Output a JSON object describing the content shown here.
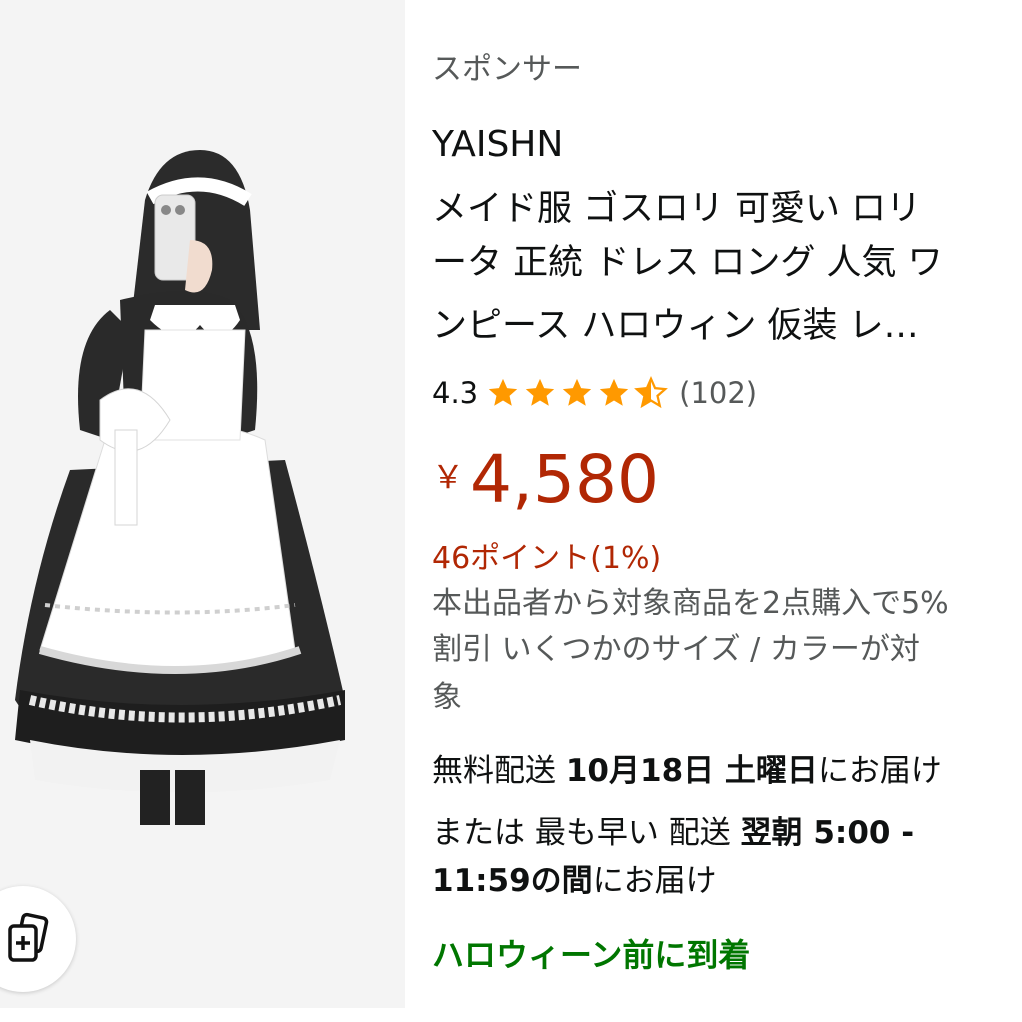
{
  "product": {
    "sponsored_label": "スポンサー",
    "brand": "YAISHN",
    "title_lines": [
      "メイド服 ゴスロリ 可愛い ロリ",
      "ータ 正統 ドレス ロング 人気 ワ",
      "ンピース ハロウィン 仮装 レ…"
    ],
    "rating": {
      "value": "4.3",
      "stars": 4.3,
      "review_count": "(102)"
    },
    "price": {
      "currency": "￥",
      "amount": "4,580"
    },
    "points": "46ポイント(1%)",
    "promo_lines": [
      "本出品者から対象商品を2点購入で5%",
      "割引 いくつかのサイズ / カラーが対",
      "象"
    ],
    "delivery": {
      "line1_prefix": "無料配送 ",
      "line1_date": "10月18日 土曜日",
      "line1_suffix": "にお届け",
      "line2_prefix": "または 最も早い 配送 ",
      "line2_bold": "翌朝 5:00 -",
      "line3_bold": "11:59の間",
      "line3_suffix": "にお届け"
    },
    "halloween_badge": "ハロウィーン前に到着"
  },
  "image": {
    "compare_icon": "add-to-compare-icon"
  },
  "colors": {
    "price_red": "#b12704",
    "star_orange": "#ff9900",
    "green": "#007600",
    "image_bg": "#f4f4f4"
  }
}
